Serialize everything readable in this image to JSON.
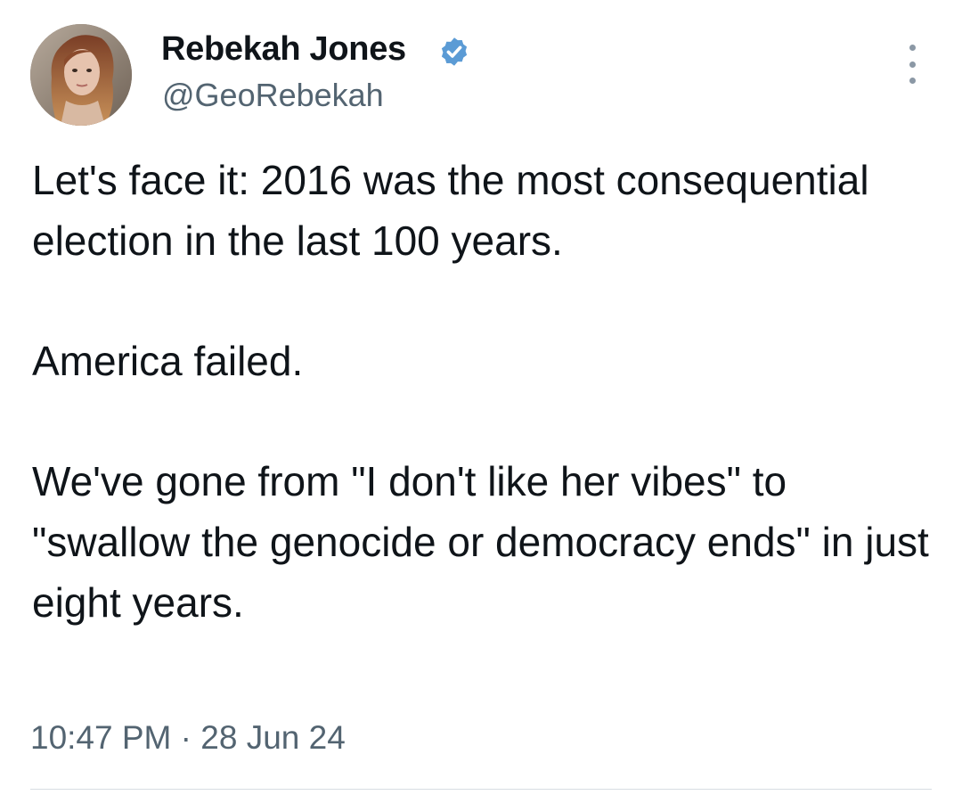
{
  "author": {
    "name": "Rebekah Jones",
    "handle": "@GeoRebekah",
    "verified": true,
    "verified_icon": "verified-badge-icon",
    "verified_color": "#5b9bd5"
  },
  "menu": {
    "icon": "more-vertical-icon"
  },
  "tweet": {
    "paragraphs": [
      "Let's face it: 2016 was the most consequential election in the last 100 years.",
      "America failed.",
      "We've gone from \"I don't like her vibes\" to \"swallow the genocide or democracy ends\" in just eight years."
    ],
    "time": "10:47 PM",
    "separator": "·",
    "date": "28 Jun 24"
  },
  "colors": {
    "text": "#0f1419",
    "secondary": "#536471",
    "background": "#ffffff"
  }
}
